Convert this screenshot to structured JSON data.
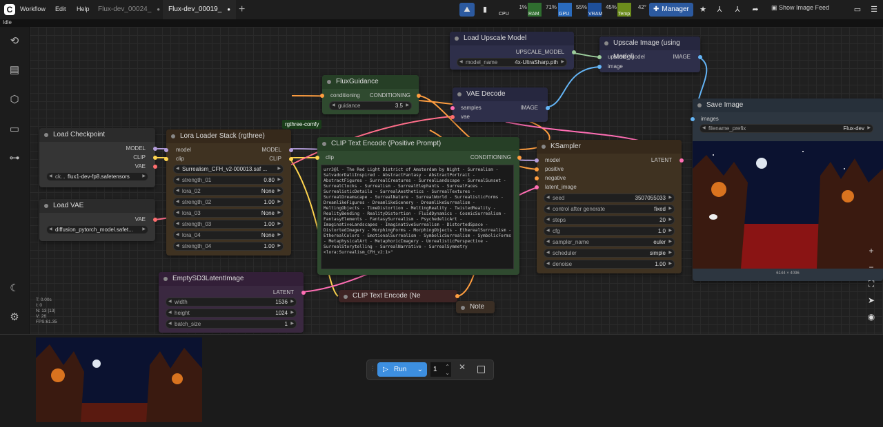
{
  "status_text": "Idle",
  "menu": [
    "Workflow",
    "Edit",
    "Help"
  ],
  "tabs": [
    {
      "label": "Flux-dev_00024_",
      "active": false
    },
    {
      "label": "Flux-dev_00019_",
      "active": true
    }
  ],
  "monitor": {
    "cpu": {
      "label": "CPU",
      "value": "1%",
      "color": "#3c3c3c"
    },
    "ram": {
      "label": "RAM",
      "value": "71%",
      "color": "#2f6e2f"
    },
    "gpu": {
      "label": "GPU",
      "value": "55%",
      "color": "#2a6bbd"
    },
    "vram": {
      "label": "VRAM",
      "value": "45%",
      "color": "#1e4f9a"
    },
    "temp": {
      "label": "Temp",
      "value": "42°",
      "color": "#6c8c1c"
    }
  },
  "toolbar": {
    "manager_label": "Manager",
    "show_image_feed": "Show Image Feed"
  },
  "accent_color": "#2c5aa0",
  "nodes": {
    "load_checkpoint": {
      "title": "Load Checkpoint",
      "outputs": [
        "MODEL",
        "CLIP",
        "VAE"
      ],
      "ckpt_label": "ck...",
      "ckpt_value": "flux1-dev-fp8.safetensors"
    },
    "load_vae": {
      "title": "Load VAE",
      "output": "VAE",
      "vae_value": "diffusion_pytorch_model.safet..."
    },
    "lora_stack": {
      "title": "Lora Loader Stack (rgthree)",
      "badge": "rgthree-comfy",
      "inputs": [
        "model",
        "clip"
      ],
      "outputs": [
        "MODEL",
        "CLIP"
      ],
      "widgets": [
        {
          "label": "Surrealism_CFH_v2-000013.saf ...",
          "value": ""
        },
        {
          "label": "strength_01",
          "value": "0.80"
        },
        {
          "label": "lora_02",
          "value": "None"
        },
        {
          "label": "strength_02",
          "value": "1.00"
        },
        {
          "label": "lora_03",
          "value": "None"
        },
        {
          "label": "strength_03",
          "value": "1.00"
        },
        {
          "label": "lora_04",
          "value": "None"
        },
        {
          "label": "strength_04",
          "value": "1.00"
        }
      ]
    },
    "flux_guidance": {
      "title": "FluxGuidance",
      "input": "conditioning",
      "output": "CONDITIONING",
      "widget_label": "guidance",
      "widget_value": "3.5"
    },
    "clip_text_pos": {
      "title": "CLIP Text Encode (Positive Prompt)",
      "input": "clip",
      "output": "CONDITIONING",
      "text": "urr3@l - The Red Light District of Amsterdam by Night - Surrealism - SalvadorDaliInspired - AbstractFantasy - AbstractPortrait - AbstractFigures - SurrealCreatures - SurrealLandscape - SurrealSunset - SurrealClocks - Surrealism - SurrealElephants - SurrealFaces - SurrealisticDetails - SurrealAesthetics - SurrealTextures - SurrealDreamscape - SurrealNature - SurrealWorld - SurrealisticForms - DreamlikeFigures - DreamlikeScenery - DreamlikeSurrealism - MeltingObjects - TimeDistortion - MeltingReality - TwistedReality - RealityBending - RealityDistortion - FluidDynamics - CosmicSurrealism - FantasyElements - FantasySurrealism - PsychedelicArt - ImaginativeLandscapes - ImaginativeSurrealism - DistortedSpace - DistortedImagery - MorphingForms - MorphingObjects - EtherealSurrealism - EtherealColors - EmotionalSurrealism - SymbolicSurrealism - SymbolicForms - MetaphysicalArt - MetaphoricImagery - UnrealisticPerspective - SurrealStorytelling - SurrealNarrative - SurrealSymmetry <lora:Surrealism_CFH_v2:1>\""
    },
    "clip_text_neg": {
      "title": "CLIP Text Encode (Ne"
    },
    "note": {
      "title": "Note"
    },
    "empty_latent": {
      "title": "EmptySD3LatentImage",
      "output": "LATENT",
      "widgets": [
        {
          "label": "width",
          "value": "1536"
        },
        {
          "label": "height",
          "value": "1024"
        },
        {
          "label": "batch_size",
          "value": "1"
        }
      ]
    },
    "load_upscale": {
      "title": "Load Upscale Model",
      "output": "UPSCALE_MODEL",
      "widget_label": "model_name",
      "widget_value": "4x-UltraSharp.pth"
    },
    "upscale_image": {
      "title": "Upscale Image (using Model)",
      "inputs": [
        "upscale_model",
        "image"
      ],
      "output": "IMAGE"
    },
    "vae_decode": {
      "title": "VAE Decode",
      "inputs": [
        "samples",
        "vae"
      ],
      "output": "IMAGE"
    },
    "ksampler": {
      "title": "KSampler",
      "inputs": [
        "model",
        "positive",
        "negative",
        "latent_image"
      ],
      "output": "LATENT",
      "widgets": [
        {
          "label": "seed",
          "value": "3507055033"
        },
        {
          "label": "control after generate",
          "value": "fixed"
        },
        {
          "label": "steps",
          "value": "20"
        },
        {
          "label": "cfg",
          "value": "1.0"
        },
        {
          "label": "sampler_name",
          "value": "euler"
        },
        {
          "label": "scheduler",
          "value": "simple"
        },
        {
          "label": "denoise",
          "value": "1.00"
        }
      ]
    },
    "save_image": {
      "title": "Save Image",
      "input": "images",
      "widget_label": "filename_prefix",
      "widget_value": "Flux-dev",
      "image_size": "6144 × 4096"
    }
  },
  "canvas_stats": [
    "T: 0.00s",
    "I: 0",
    "N: 13 [13]",
    "V: 26",
    "FPS:61.35"
  ],
  "run": {
    "label": "Run",
    "count": "1"
  }
}
